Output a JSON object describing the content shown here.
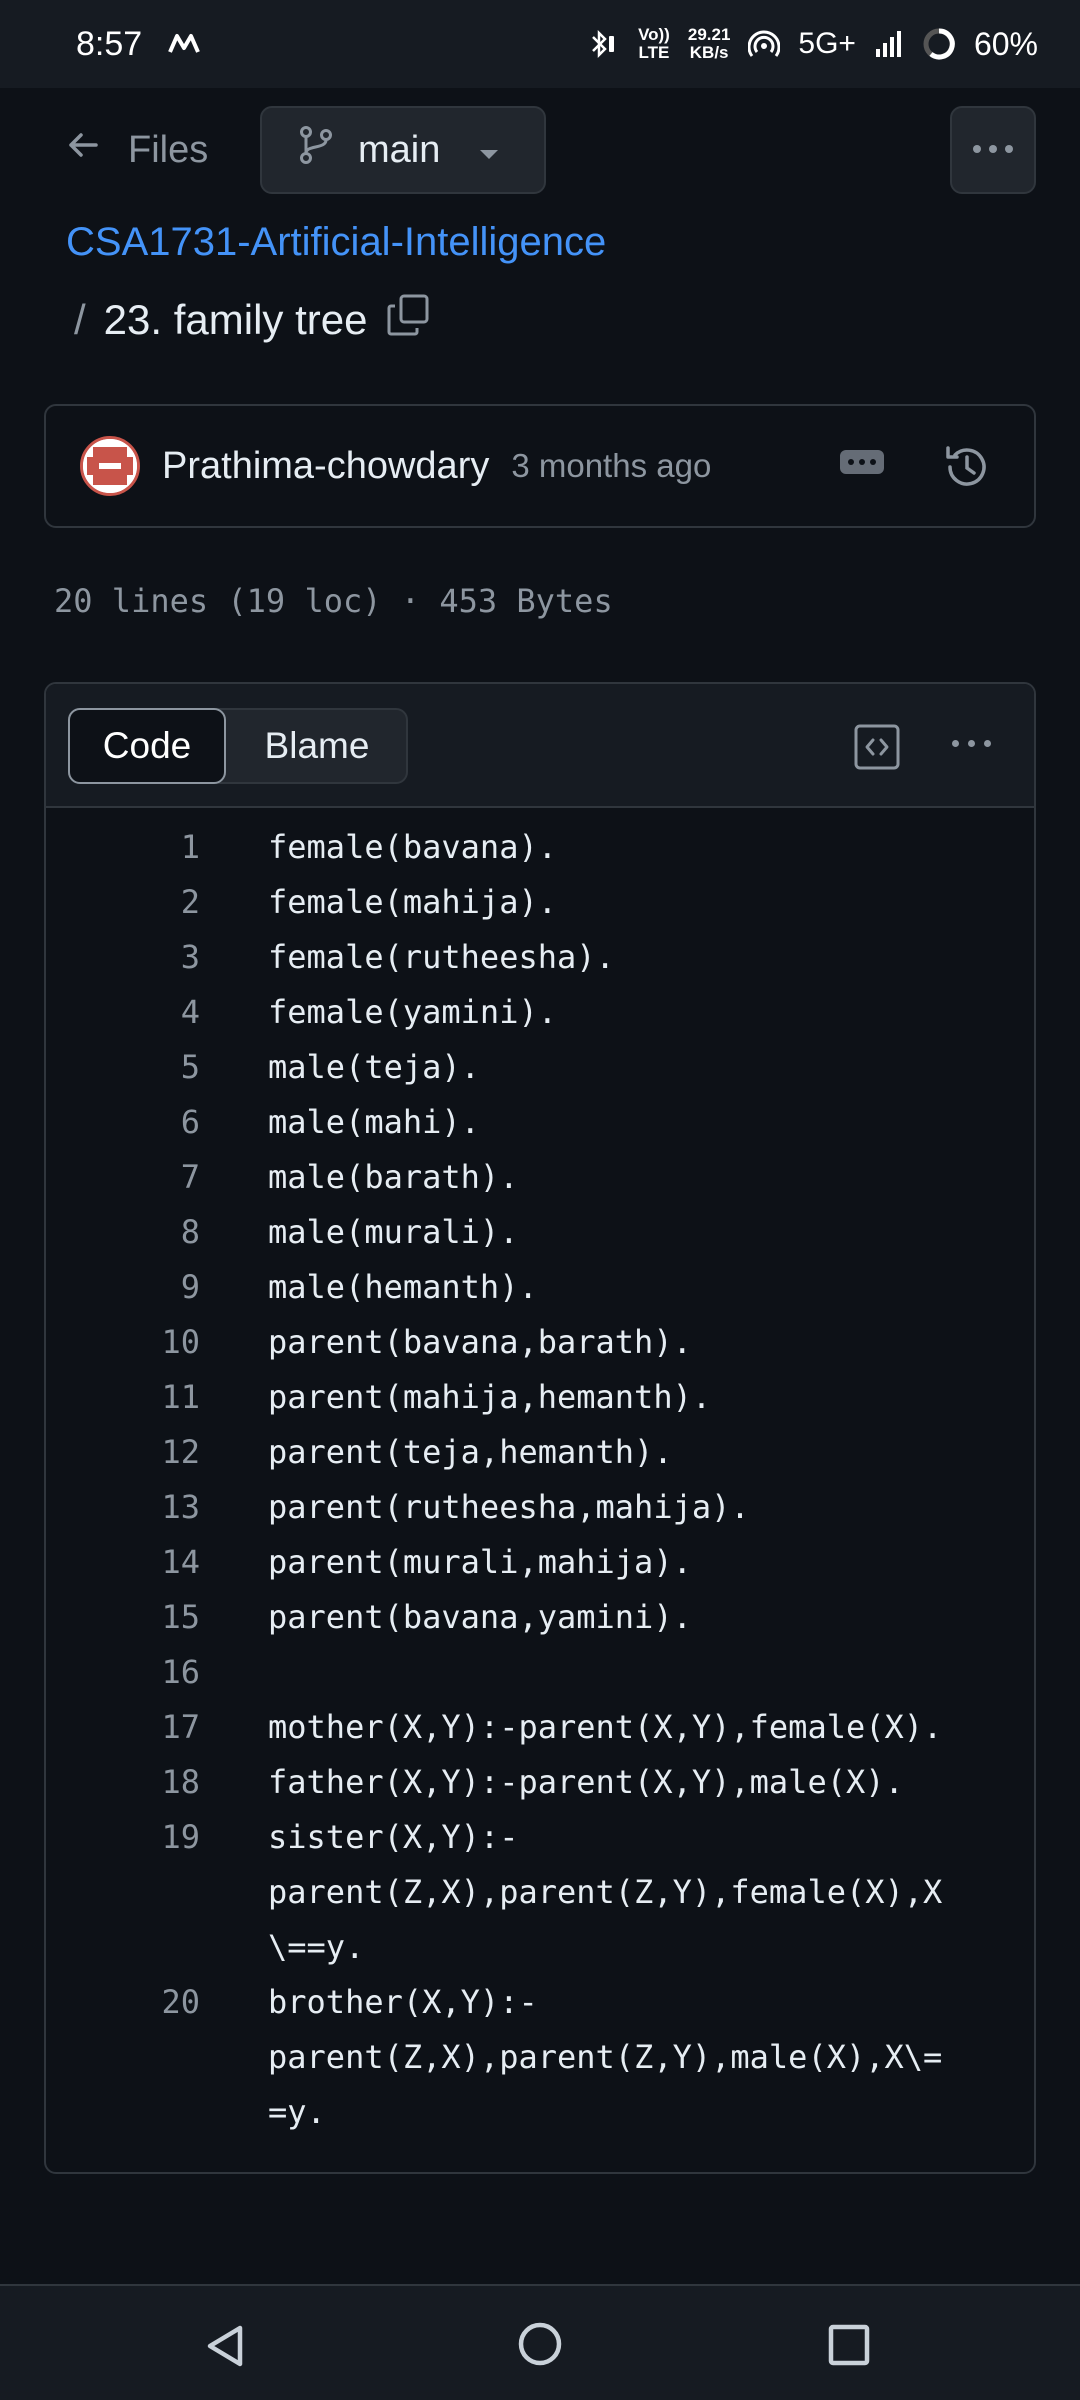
{
  "status_bar": {
    "time": "8:57",
    "carrier_icon": "m-logo-icon",
    "volte_top": "Vo))",
    "volte_bottom": "LTE",
    "speed_top": "29.21",
    "speed_bottom": "KB/s",
    "network": "5G+",
    "battery": "60%"
  },
  "nav": {
    "back_label": "Files",
    "branch": "main"
  },
  "breadcrumb": {
    "repo": "CSA1731-Artificial-Intelligence",
    "separator": "/",
    "file": "23. family tree"
  },
  "commit": {
    "author": "Prathima-chowdary",
    "time": "3 months ago"
  },
  "file_info": "20 lines (19 loc) · 453 Bytes",
  "code_view": {
    "tabs": [
      {
        "label": "Code",
        "active": true
      },
      {
        "label": "Blame",
        "active": false
      }
    ],
    "lines": [
      {
        "num": "1",
        "text": "female(bavana)."
      },
      {
        "num": "2",
        "text": "female(mahija)."
      },
      {
        "num": "3",
        "text": "female(rutheesha)."
      },
      {
        "num": "4",
        "text": "female(yamini)."
      },
      {
        "num": "5",
        "text": "male(teja)."
      },
      {
        "num": "6",
        "text": "male(mahi)."
      },
      {
        "num": "7",
        "text": "male(barath)."
      },
      {
        "num": "8",
        "text": "male(murali)."
      },
      {
        "num": "9",
        "text": "male(hemanth)."
      },
      {
        "num": "10",
        "text": "parent(bavana,barath)."
      },
      {
        "num": "11",
        "text": "parent(mahija,hemanth)."
      },
      {
        "num": "12",
        "text": "parent(teja,hemanth)."
      },
      {
        "num": "13",
        "text": "parent(rutheesha,mahija)."
      },
      {
        "num": "14",
        "text": "parent(murali,mahija)."
      },
      {
        "num": "15",
        "text": "parent(bavana,yamini)."
      },
      {
        "num": "16",
        "text": ""
      },
      {
        "num": "17",
        "text": "mother(X,Y):-parent(X,Y),female(X)."
      },
      {
        "num": "18",
        "text": "father(X,Y):-parent(X,Y),male(X)."
      },
      {
        "num": "19",
        "text": "sister(X,Y):-\nparent(Z,X),parent(Z,Y),female(X),X\n\\==y."
      },
      {
        "num": "20",
        "text": "brother(X,Y):-\nparent(Z,X),parent(Z,Y),male(X),X\\=\n=y."
      }
    ]
  }
}
